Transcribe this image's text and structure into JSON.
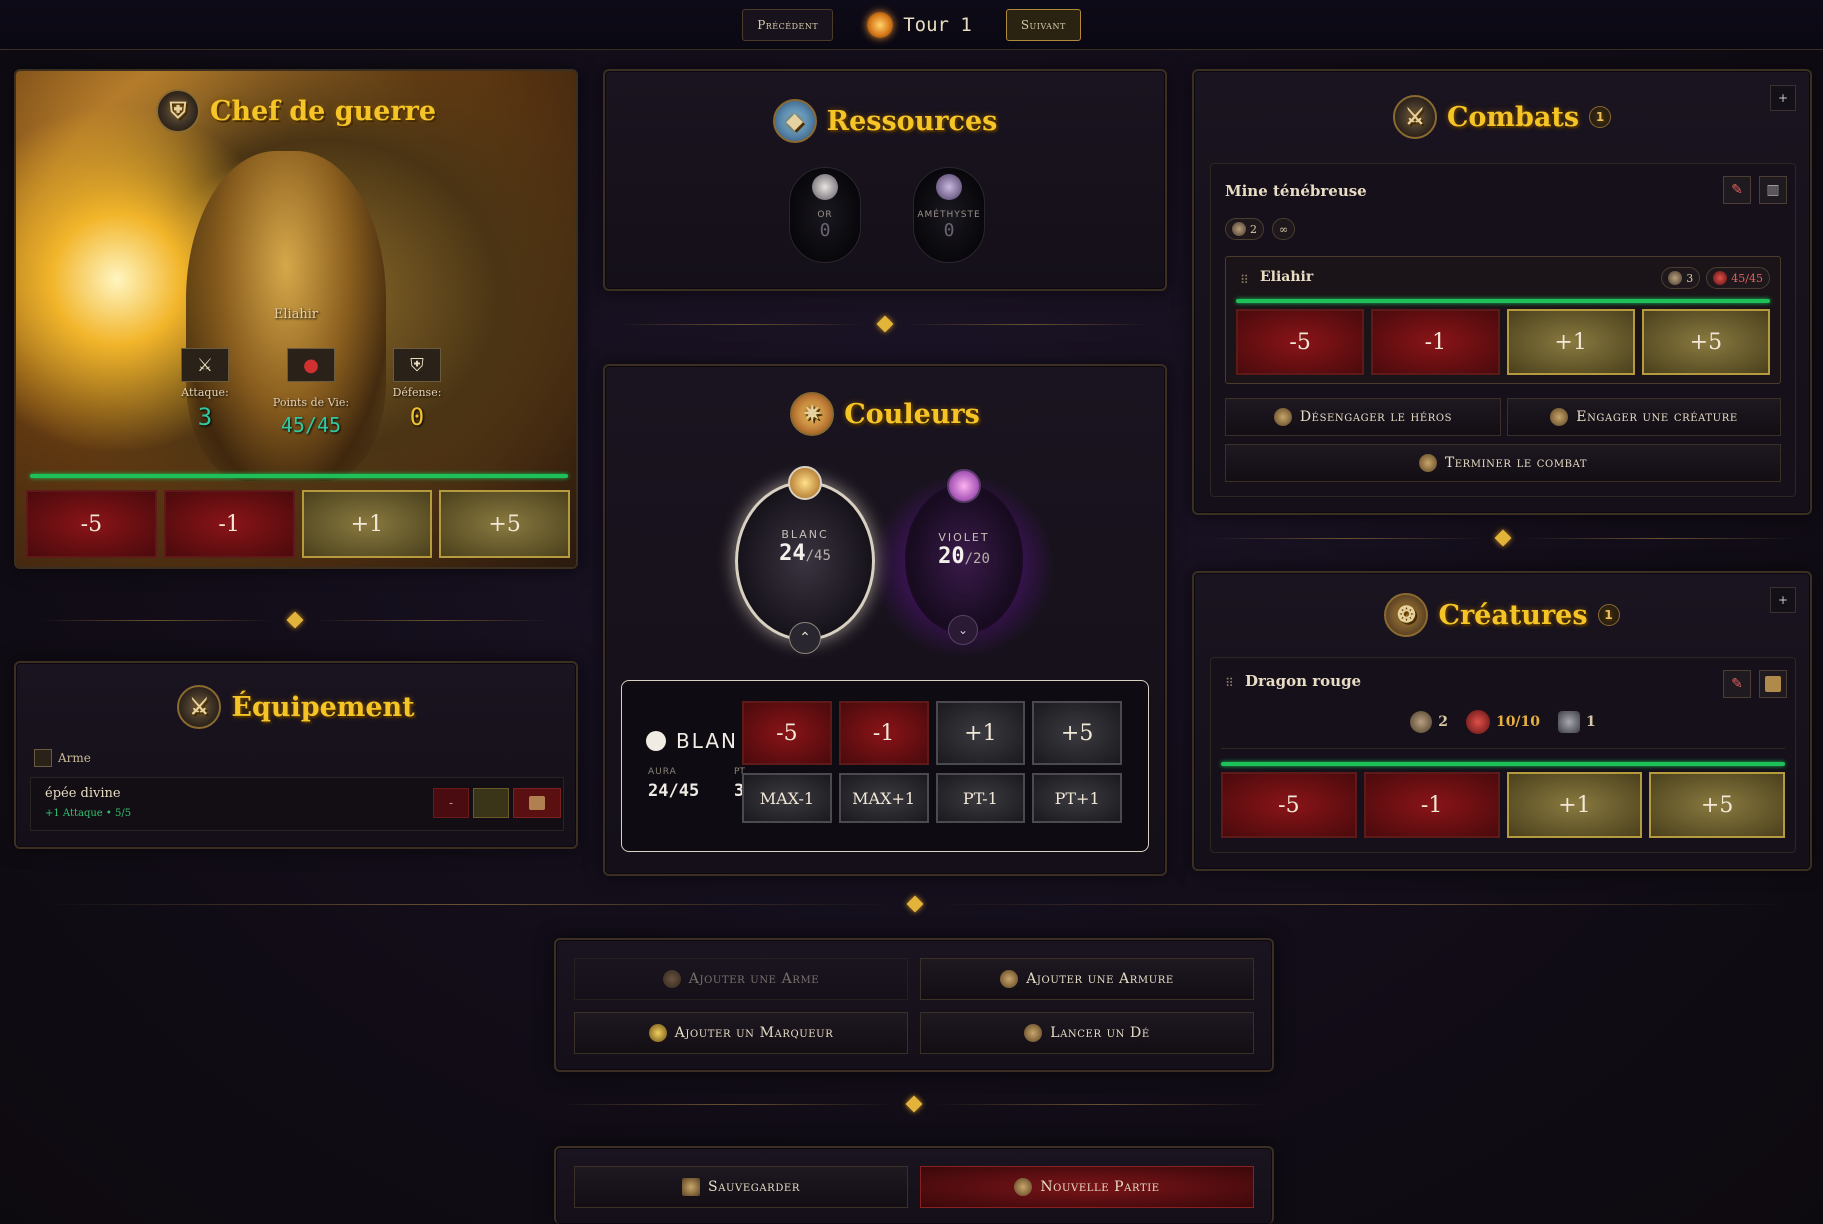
{
  "topbar": {
    "prev_label": "Précédent",
    "turn_label": "Tour 1",
    "next_label": "Suivant"
  },
  "hero": {
    "title": "Chef de guerre",
    "name": "Eliahir",
    "attack_label": "Attaque:",
    "attack_value": "3",
    "hp_label": "Points de Vie:",
    "hp_value": "45/45",
    "defense_label": "Défense:",
    "defense_value": "0",
    "hp_fraction": 1.0,
    "buttons": [
      "-5",
      "-1",
      "+1",
      "+5"
    ]
  },
  "equipment": {
    "title": "Équipement",
    "category_label": "Arme",
    "item_name": "épée divine",
    "item_detail": "+1 Attaque • 5/5",
    "item_minus_label": "-"
  },
  "resources": {
    "title": "Ressources",
    "items": [
      {
        "label": "OR",
        "value": "0"
      },
      {
        "label": "AMÉTHYSTE",
        "value": "0"
      }
    ]
  },
  "colors": {
    "title": "Couleurs",
    "orbs": [
      {
        "label": "BLANC",
        "value": "24",
        "max": "/45"
      },
      {
        "label": "VIOLET",
        "value": "20",
        "max": "/20"
      }
    ],
    "detail": {
      "name": "BLAN",
      "aura_label": "AURA",
      "aura_value": "24/45",
      "pt_label": "PT",
      "pt_value": "3"
    },
    "buttons_row1": [
      "-5",
      "-1",
      "+1",
      "+5"
    ],
    "buttons_row2": [
      "MAX-1",
      "MAX+1",
      "PT-1",
      "PT+1"
    ]
  },
  "combats": {
    "title": "Combats",
    "count": "1",
    "add_label": "+",
    "card_title": "Mine ténébreuse",
    "chip_attack": "2",
    "chip_infinite": "∞",
    "fighter": {
      "name": "Eliahir",
      "attack": "3",
      "hp": "45/45",
      "hp_fraction": 1.0
    },
    "buttons": [
      "-5",
      "-1",
      "+1",
      "+5"
    ],
    "disengage_label": "Désengager le héros",
    "engage_label": "Engager une créature",
    "end_label": "Terminer le combat"
  },
  "creatures": {
    "title": "Créatures",
    "count": "1",
    "add_label": "+",
    "name": "Dragon rouge",
    "attack": "2",
    "hp": "10/10",
    "defense": "1",
    "hp_fraction": 1.0,
    "buttons": [
      "-5",
      "-1",
      "+1",
      "+5"
    ]
  },
  "actions": {
    "add_weapon": "Ajouter une Arme",
    "add_armor": "Ajouter une Armure",
    "add_marker": "Ajouter un Marqueur",
    "roll_die": "Lancer un Dé"
  },
  "footer": {
    "save": "Sauvegarder",
    "new_game": "Nouvelle Partie"
  },
  "accent_colors": {
    "gold": "#f5c426",
    "red": "#8a1418",
    "green": "#1ec05a",
    "violet": "#8a2ab8"
  }
}
